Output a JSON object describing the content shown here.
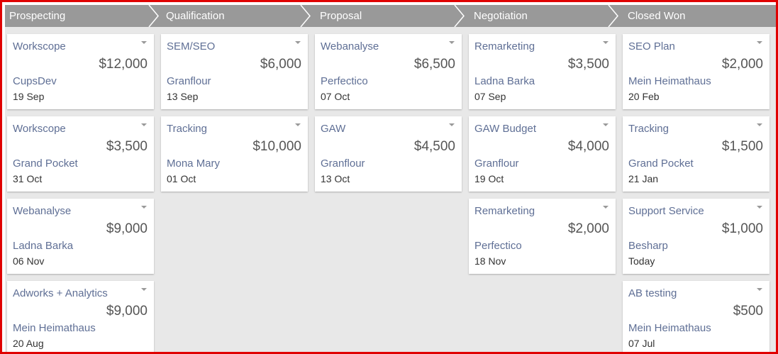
{
  "stages": [
    {
      "name": "Prospecting"
    },
    {
      "name": "Qualification"
    },
    {
      "name": "Proposal"
    },
    {
      "name": "Negotiation"
    },
    {
      "name": "Closed Won"
    }
  ],
  "columns": [
    {
      "cards": [
        {
          "title": "Workscope",
          "amount": "$12,000",
          "company": "CupsDev",
          "date": "19 Sep"
        },
        {
          "title": "Workscope",
          "amount": "$3,500",
          "company": "Grand Pocket",
          "date": "31 Oct"
        },
        {
          "title": "Webanalyse",
          "amount": "$9,000",
          "company": "Ladna Barka",
          "date": "06 Nov"
        },
        {
          "title": "Adworks + Analytics",
          "amount": "$9,000",
          "company": "Mein Heimathaus",
          "date": "20 Aug"
        }
      ]
    },
    {
      "cards": [
        {
          "title": "SEM/SEO",
          "amount": "$6,000",
          "company": "Granflour",
          "date": "13 Sep"
        },
        {
          "title": "Tracking",
          "amount": "$10,000",
          "company": "Mona Mary",
          "date": "01 Oct"
        }
      ]
    },
    {
      "cards": [
        {
          "title": "Webanalyse",
          "amount": "$6,500",
          "company": "Perfectico",
          "date": "07 Oct"
        },
        {
          "title": "GAW",
          "amount": "$4,500",
          "company": "Granflour",
          "date": "13 Oct"
        }
      ]
    },
    {
      "cards": [
        {
          "title": "Remarketing",
          "amount": "$3,500",
          "company": "Ladna Barka",
          "date": "07 Sep"
        },
        {
          "title": "GAW Budget",
          "amount": "$4,000",
          "company": "Granflour",
          "date": "19 Oct"
        },
        {
          "title": "Remarketing",
          "amount": "$2,000",
          "company": "Perfectico",
          "date": "18 Nov"
        }
      ]
    },
    {
      "cards": [
        {
          "title": "SEO Plan",
          "amount": "$2,000",
          "company": "Mein Heimathaus",
          "date": "20 Feb"
        },
        {
          "title": "Tracking",
          "amount": "$1,500",
          "company": "Grand Pocket",
          "date": "21 Jan"
        },
        {
          "title": "Support Service",
          "amount": "$1,000",
          "company": "Besharp",
          "date": "Today"
        },
        {
          "title": "AB testing",
          "amount": "$500",
          "company": "Mein Heimathaus",
          "date": "07 Jul"
        }
      ]
    }
  ],
  "icons": {
    "card_menu": "caret-down-icon",
    "stage_separator": "chevron-right-icon"
  },
  "colors": {
    "stage_bar": "#999999",
    "board": "#e8e8e8",
    "frame_border": "#e00000",
    "link_text": "#5f6f95"
  }
}
